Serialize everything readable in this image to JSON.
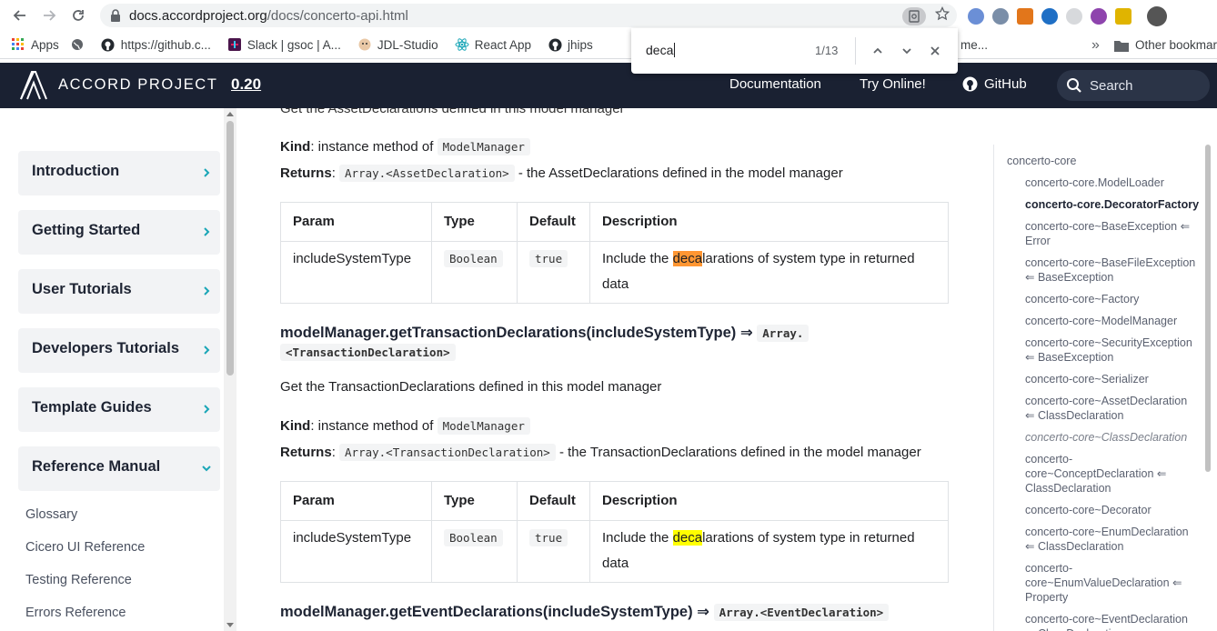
{
  "browser": {
    "url_host": "docs.accordproject.org",
    "url_path": "/docs/concerto-api.html",
    "bookmarks": [
      {
        "label": "Apps",
        "icon": "apps-grid-icon"
      },
      {
        "label": "",
        "icon": "globe-icon"
      },
      {
        "label": "https://github.c...",
        "icon": "github-icon"
      },
      {
        "label": "Slack | gsoc | A...",
        "icon": "slack-icon"
      },
      {
        "label": "JDL-Studio",
        "icon": "jhipster-icon"
      },
      {
        "label": "React App",
        "icon": "react-icon"
      },
      {
        "label": "jhips",
        "icon": "github-icon"
      }
    ],
    "bookmark_overflow": "me...",
    "other_bookmarks": "Other bookmar"
  },
  "find": {
    "query": "deca",
    "count": "1/13"
  },
  "header": {
    "brand": "ACCORD PROJECT",
    "version": "0.20",
    "nav": [
      "Documentation",
      "Try Online!",
      "GitHub"
    ],
    "search_placeholder": "Search"
  },
  "sidebar": {
    "sections": [
      {
        "label": "Introduction",
        "expanded": false
      },
      {
        "label": "Getting Started",
        "expanded": false
      },
      {
        "label": "User Tutorials",
        "expanded": false
      },
      {
        "label": "Developers Tutorials",
        "expanded": false
      },
      {
        "label": "Template Guides",
        "expanded": false
      },
      {
        "label": "Reference Manual",
        "expanded": true
      }
    ],
    "sublinks": [
      "Glossary",
      "Cicero UI Reference",
      "Testing Reference",
      "Errors Reference"
    ]
  },
  "content": {
    "top_line": "Get the AssetDeclarations defined in this model manager",
    "block1": {
      "kind_label": "Kind",
      "kind_text": ": instance method of ",
      "kind_code": "ModelManager",
      "returns_label": "Returns",
      "returns_code": "Array.<AssetDeclaration>",
      "returns_text": " - the AssetDeclarations defined in the model manager",
      "table": {
        "headers": [
          "Param",
          "Type",
          "Default",
          "Description"
        ],
        "param": "includeSystemType",
        "type": "Boolean",
        "default": "true",
        "desc_pre": "Include the ",
        "desc_match": "deca",
        "desc_post": "larations of system type in returned data"
      }
    },
    "heading2": {
      "text": "modelManager.getTransactionDeclarations(includeSystemType) ⇒ ",
      "code_line1": "Array.",
      "code_line2": "<TransactionDeclaration>"
    },
    "block2": {
      "summary": "Get the TransactionDeclarations defined in this model manager",
      "kind_label": "Kind",
      "kind_text": ": instance method of ",
      "kind_code": "ModelManager",
      "returns_label": "Returns",
      "returns_code": "Array.<TransactionDeclaration>",
      "returns_text": " - the TransactionDeclarations defined in the model manager",
      "table": {
        "headers": [
          "Param",
          "Type",
          "Default",
          "Description"
        ],
        "param": "includeSystemType",
        "type": "Boolean",
        "default": "true",
        "desc_pre": "Include the ",
        "desc_match": "deca",
        "desc_post": "larations of system type in returned data"
      }
    },
    "heading3": {
      "text": "modelManager.getEventDeclarations(includeSystemType) ⇒ ",
      "code": "Array.<EventDeclaration>"
    }
  },
  "toc": {
    "root": "concerto-core",
    "items": [
      {
        "lines": [
          "concerto-core.ModelLoader"
        ],
        "style": "normal"
      },
      {
        "lines": [
          "concerto-core.DecoratorFactory"
        ],
        "style": "active"
      },
      {
        "lines": [
          "concerto-core~BaseException ⇐",
          "Error"
        ],
        "style": "normal"
      },
      {
        "lines": [
          "concerto-core~BaseFileException",
          "⇐ BaseException"
        ],
        "style": "normal"
      },
      {
        "lines": [
          "concerto-core~Factory"
        ],
        "style": "normal"
      },
      {
        "lines": [
          "concerto-core~ModelManager"
        ],
        "style": "normal"
      },
      {
        "lines": [
          "concerto-core~SecurityException",
          "⇐ BaseException"
        ],
        "style": "normal"
      },
      {
        "lines": [
          "concerto-core~Serializer"
        ],
        "style": "normal"
      },
      {
        "lines": [
          "concerto-core~AssetDeclaration",
          "⇐ ClassDeclaration"
        ],
        "style": "normal"
      },
      {
        "lines": [
          "concerto-core~ClassDeclaration"
        ],
        "style": "italic"
      },
      {
        "lines": [
          "concerto-",
          "core~ConceptDeclaration ⇐",
          "ClassDeclaration"
        ],
        "style": "normal"
      },
      {
        "lines": [
          "concerto-core~Decorator"
        ],
        "style": "normal"
      },
      {
        "lines": [
          "concerto-core~EnumDeclaration",
          "⇐ ClassDeclaration"
        ],
        "style": "normal"
      },
      {
        "lines": [
          "concerto-",
          "core~EnumValueDeclaration ⇐",
          "Property"
        ],
        "style": "normal"
      },
      {
        "lines": [
          "concerto-core~EventDeclaration",
          "⇐ ClassDeclaration"
        ],
        "style": "normal"
      }
    ]
  },
  "colors": {
    "header_bg": "#1a2132",
    "accent": "#1aa6b7",
    "find_current": "#ff9632",
    "find_match": "#ffff00"
  }
}
